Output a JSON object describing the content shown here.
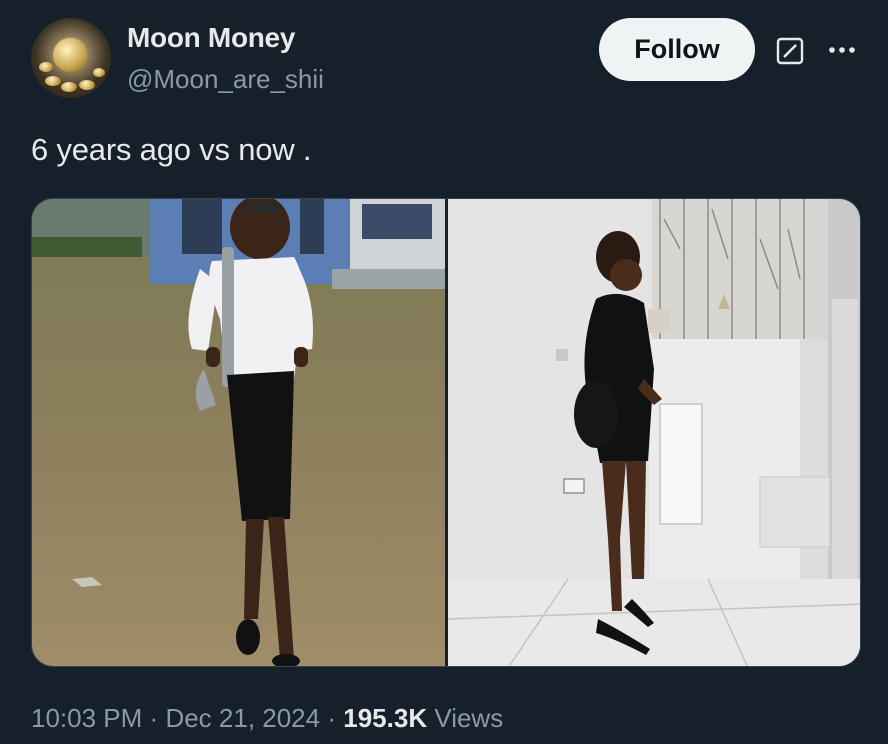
{
  "author": {
    "display_name": "Moon Money",
    "handle": "@Moon_are_shii"
  },
  "actions": {
    "follow_label": "Follow"
  },
  "tweet": {
    "text": "6 years ago vs now .",
    "time": "10:03 PM",
    "separator1": "·",
    "date": "Dec 21, 2024",
    "separator2": "·",
    "views_count": "195.3K",
    "views_label": "Views"
  },
  "media": {
    "photos": [
      "photo-before",
      "photo-after"
    ]
  },
  "colors": {
    "background": "#15202b",
    "primary_text": "#e7e9ea",
    "secondary_text": "#8b98a5",
    "button_bg": "#eff3f4"
  }
}
